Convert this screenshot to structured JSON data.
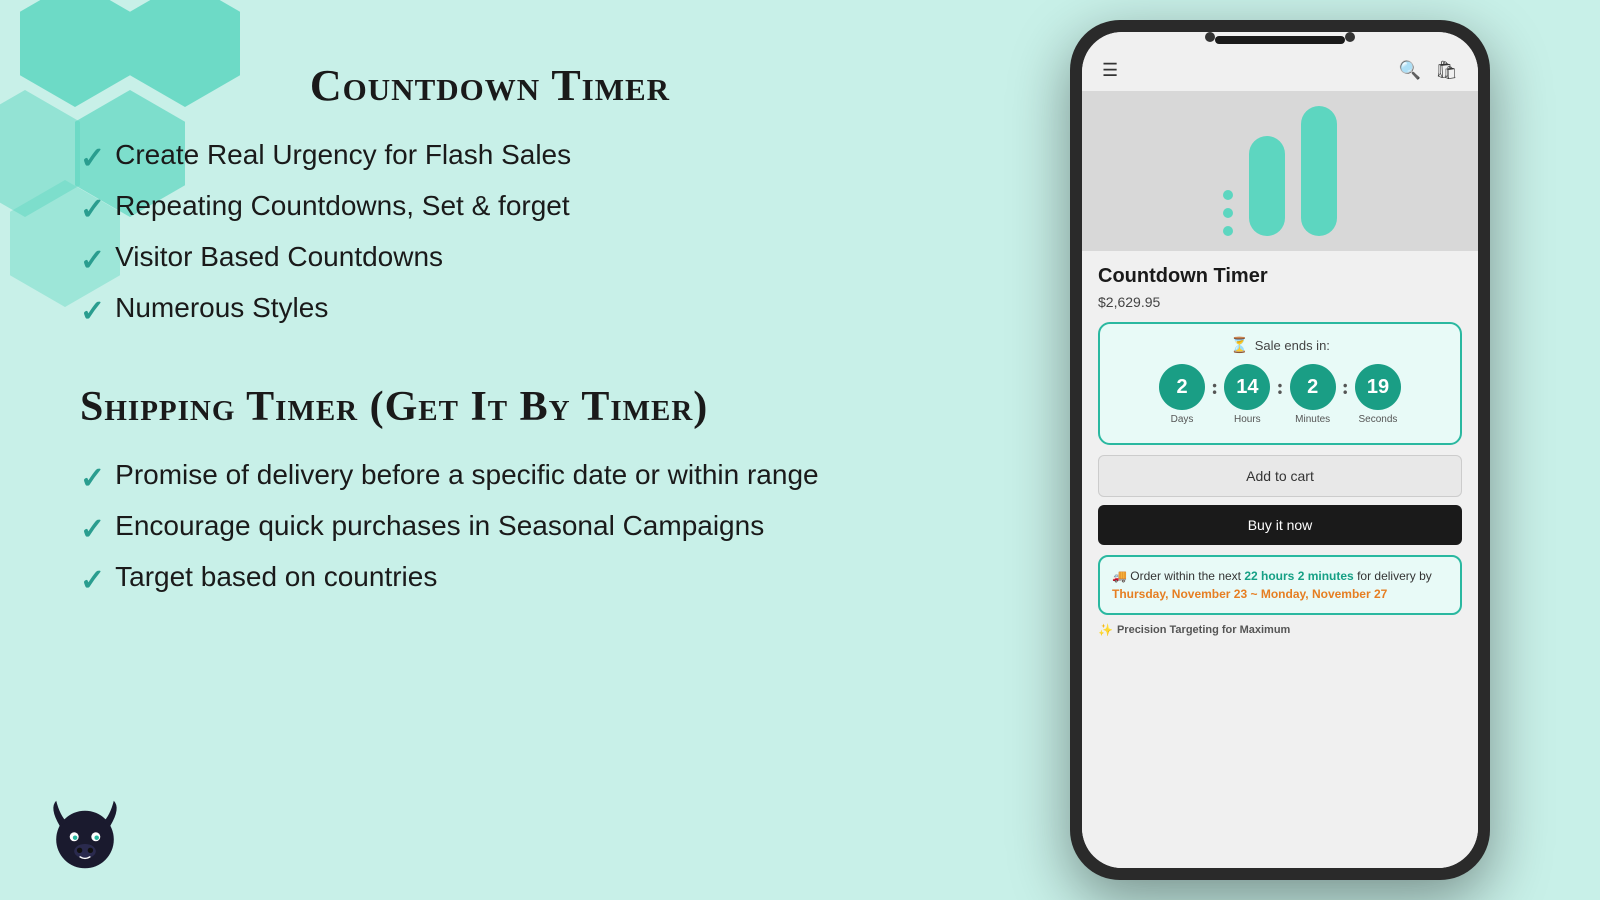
{
  "background_color": "#c8f0e8",
  "left": {
    "section1": {
      "title": "Countdown Timer",
      "features": [
        "Create Real Urgency for Flash Sales",
        "Repeating Countdowns, Set & forget",
        "Visitor Based Countdowns",
        "Numerous Styles"
      ]
    },
    "section2": {
      "title": "Shipping Timer (Get It By Timer)",
      "features": [
        "Promise of delivery before a specific date or within range",
        "Encourage quick purchases in Seasonal Campaigns",
        "Target based on countries"
      ]
    }
  },
  "phone": {
    "product_name": "Countdown Timer",
    "product_price": "$2,629.95",
    "timer": {
      "label": "Sale ends in:",
      "days_value": "2",
      "days_label": "Days",
      "hours_value": "14",
      "hours_label": "Hours",
      "minutes_value": "2",
      "minutes_label": "Minutes",
      "seconds_value": "19",
      "seconds_label": "Seconds"
    },
    "add_to_cart_label": "Add to cart",
    "buy_now_label": "Buy it now",
    "shipping": {
      "prefix": "Order within the next",
      "highlight": "22 hours 2 minutes",
      "middle": " for delivery by",
      "date_range": "Thursday, November 23 ~ Monday, November 27"
    },
    "precision_text": "Precision Targeting for Maximum"
  }
}
